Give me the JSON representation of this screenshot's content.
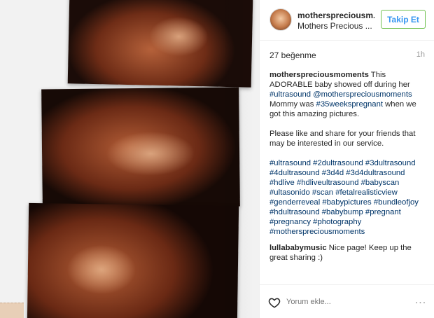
{
  "post": {
    "username": "motherspreciousm...",
    "full_name": "Mothers Precious ...",
    "follow_label": "Takip Et",
    "likes": "27 beğenme",
    "time": "1h"
  },
  "caption": {
    "user": "motherspreciousmoments",
    "t1": " This ADORABLE baby showed off during her ",
    "tag1": "#ultrasound",
    "t2": " ",
    "tag2": "@motherspreciousmoments",
    "t3": " Mommy was ",
    "tag3": "#35weekspregnant",
    "t4": " when we got this amazing pictures.",
    "t5": "Please like and share for your friends that may be interested in our service.",
    "hashtags": "#ultrasound #2dultrasound #3dultrasound #4dultrasound #3d4d #3d4dultrasound #hdlive #hdliveultrasound #babyscan #ultasonido #scan #fetalrealisticview #genderreveal #babypictures #bundleofjoy #hdultrasound #babybump #pregnant #pregnancy #photography #motherspreciousmoments"
  },
  "reply": {
    "user": "lullababymusic",
    "text": " Nice page! Keep up the great sharing :)"
  },
  "footer": {
    "placeholder": "Yorum ekle...",
    "more": "..."
  },
  "colors": {
    "follow_text": "#3897f0",
    "follow_border": "#70c050",
    "hashtag": "#003569"
  },
  "icons": {
    "like": "heart-outline-icon",
    "options": "more-options-icon"
  }
}
